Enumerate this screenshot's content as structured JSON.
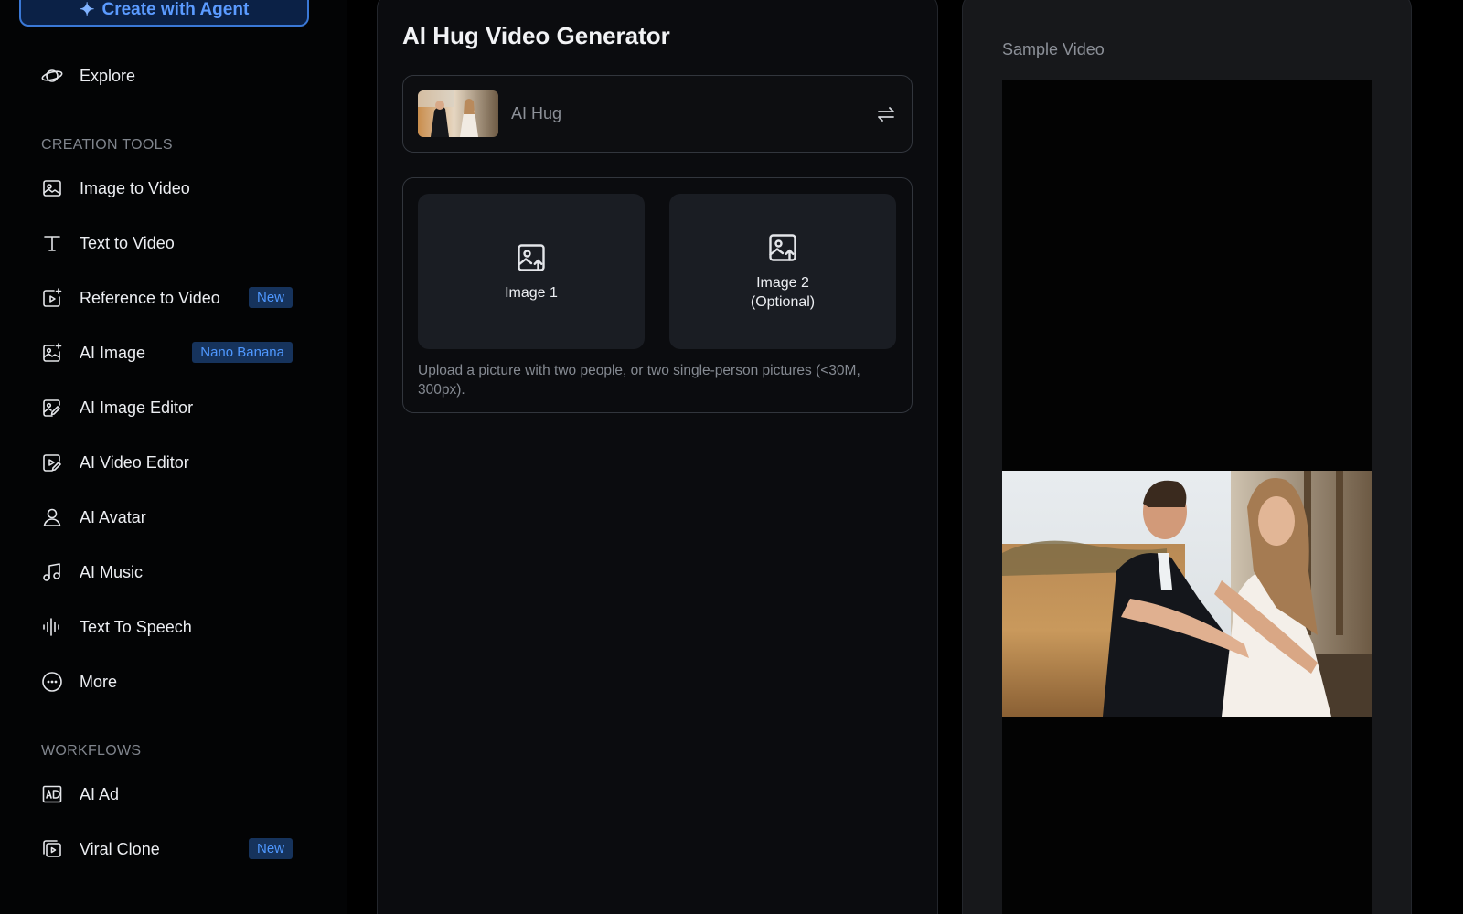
{
  "sidebar": {
    "agent_button_label": "Create with Agent",
    "explore_label": "Explore",
    "creation_tools_heading": "CREATION TOOLS",
    "tools": [
      {
        "label": "Image to Video",
        "icon": "image-icon"
      },
      {
        "label": "Text to Video",
        "icon": "text-icon"
      },
      {
        "label": "Reference to Video",
        "icon": "reference-video-icon",
        "badge": "New"
      },
      {
        "label": "AI Image",
        "icon": "image-sparkle-icon",
        "badge": "Nano Banana"
      },
      {
        "label": "AI Image Editor",
        "icon": "image-edit-icon"
      },
      {
        "label": "AI Video Editor",
        "icon": "video-edit-icon"
      },
      {
        "label": "AI Avatar",
        "icon": "avatar-icon"
      },
      {
        "label": "AI Music",
        "icon": "music-icon"
      },
      {
        "label": "Text To Speech",
        "icon": "waveform-icon"
      },
      {
        "label": "More",
        "icon": "more-icon"
      }
    ],
    "workflows_heading": "WORKFLOWS",
    "workflows": [
      {
        "label": "AI Ad",
        "icon": "ad-icon"
      },
      {
        "label": "Viral Clone",
        "icon": "viral-clone-icon",
        "badge": "New"
      }
    ]
  },
  "generator": {
    "title": "AI Hug Video Generator",
    "model_name": "AI Hug",
    "upload": {
      "image1_label": "Image 1",
      "image2_label": "Image 2",
      "image2_optional": "(Optional)",
      "hint": "Upload a picture with two people, or two single-person pictures (<30M, 300px)."
    }
  },
  "sample": {
    "label": "Sample Video"
  },
  "colors": {
    "accent": "#3a78d6",
    "badge_bg": "#16335c",
    "badge_text": "#4f98ff",
    "panel_bg": "#0b0c0f",
    "sample_bg": "#17181b"
  }
}
